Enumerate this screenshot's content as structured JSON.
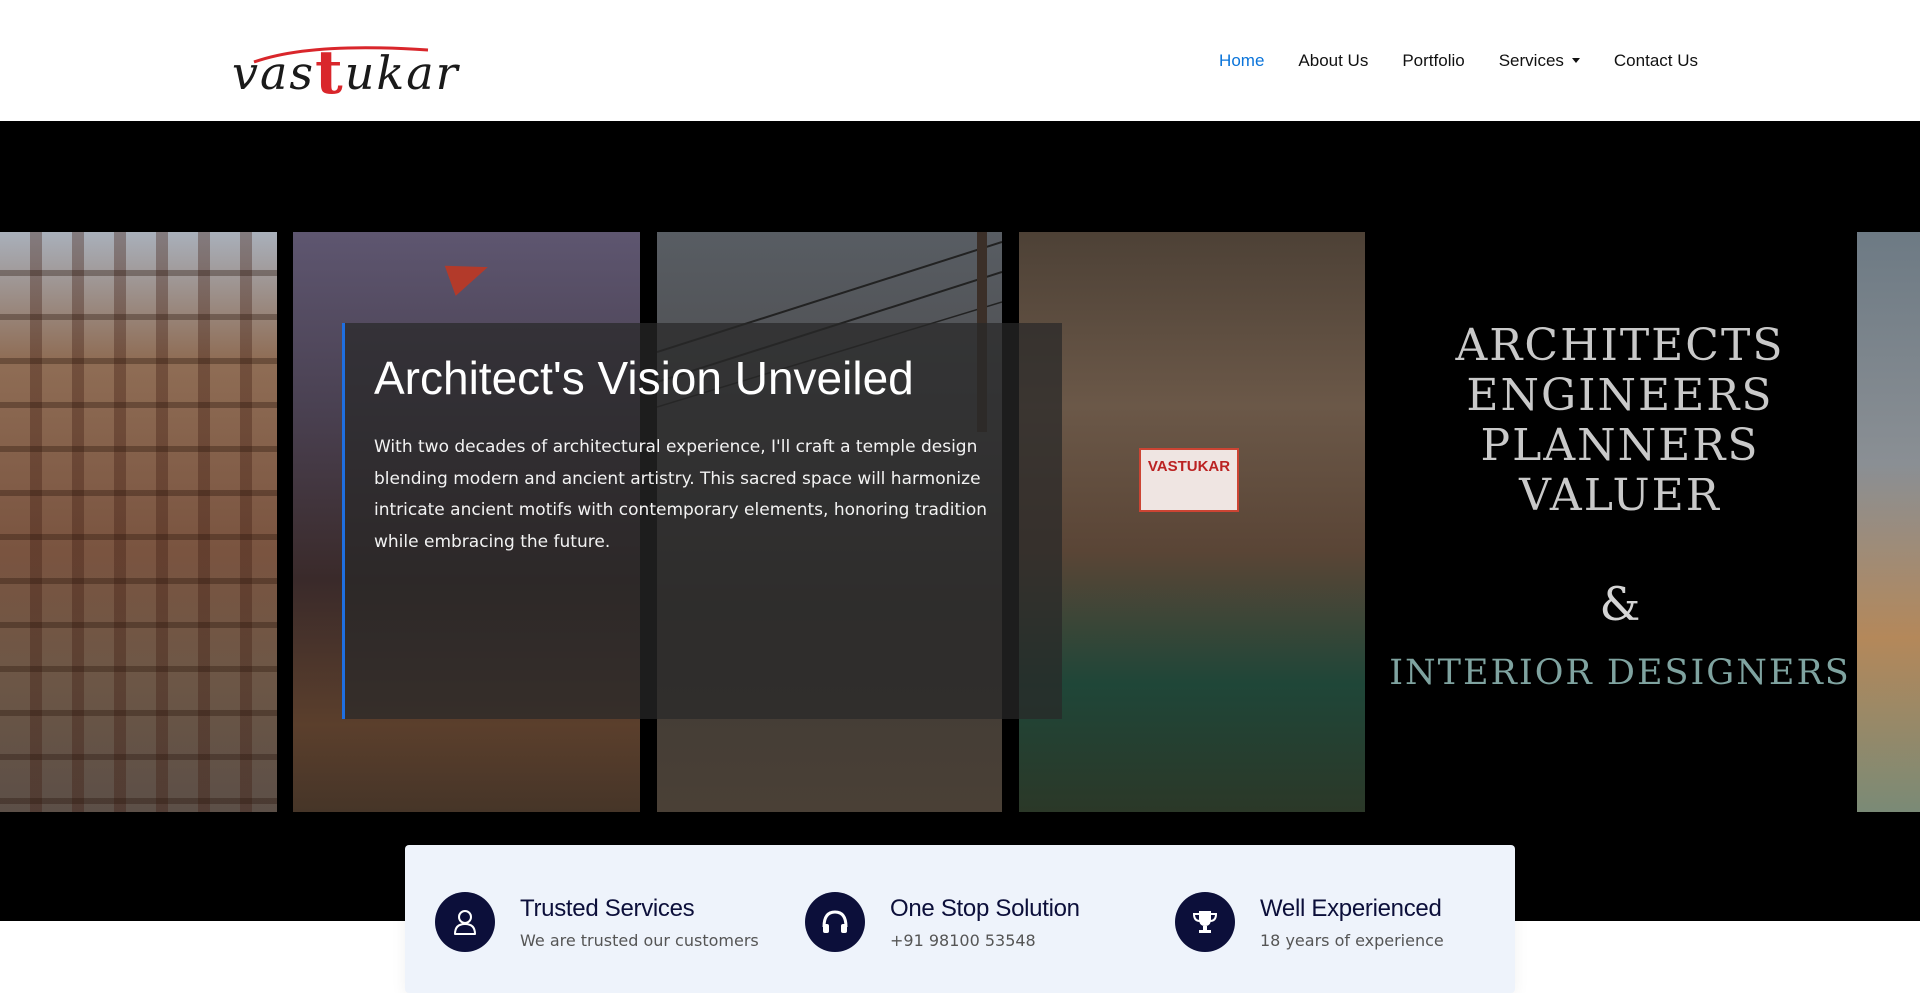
{
  "brand": {
    "logo_prefix": "vas",
    "logo_accent": "t",
    "logo_suffix": "ukar",
    "accent_color": "#d9262b"
  },
  "nav": {
    "items": [
      {
        "label": "Home",
        "active": true
      },
      {
        "label": "About Us"
      },
      {
        "label": "Portfolio"
      },
      {
        "label": "Services",
        "has_dropdown": true
      },
      {
        "label": "Contact Us"
      }
    ],
    "active_color": "#0a74da"
  },
  "hero": {
    "title": "Architect's Vision Unveiled",
    "body": "With two decades of architectural experience, I'll craft a temple design blending modern and ancient artistry. This sacred space will harmonize intricate ancient motifs with contemporary elements, honoring tradition while embracing the future.",
    "sign_text": "VASTUKAR",
    "slogan": {
      "lines": [
        "ARCHITECTS",
        "ENGINEERS",
        "PLANNERS",
        "VALUER"
      ],
      "amp": "&",
      "sub": "INTERIOR DESIGNERS"
    }
  },
  "features": [
    {
      "icon": "user-icon",
      "title": "Trusted Services",
      "subtitle": "We are trusted our customers"
    },
    {
      "icon": "headphones-icon",
      "title": "One Stop Solution",
      "subtitle": "+91 98100 53548"
    },
    {
      "icon": "trophy-icon",
      "title": "Well Experienced",
      "subtitle": "18 years of experience"
    }
  ],
  "colors": {
    "navy": "#0c0f3a",
    "features_bg": "#eef3fb",
    "caption_border": "#1f6fe0"
  }
}
